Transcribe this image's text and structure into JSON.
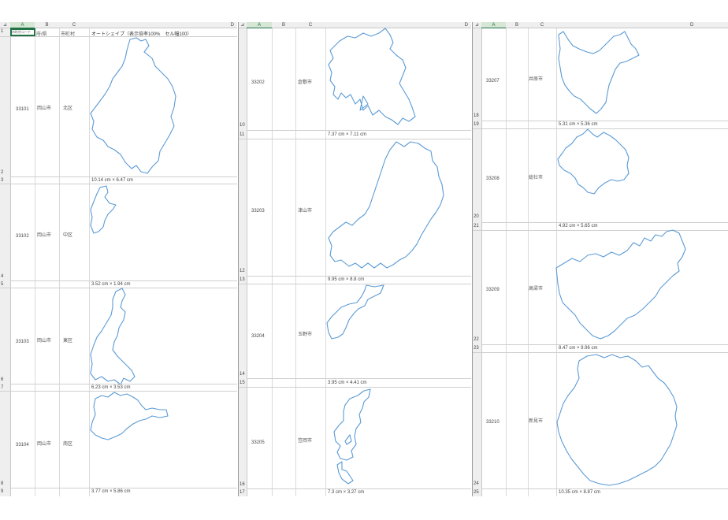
{
  "header": {
    "corner_marker": "⊿",
    "cols": [
      "A",
      "B",
      "C",
      "D"
    ],
    "row1": {
      "a": "市町村コード",
      "b": "府/県",
      "c": "市町村",
      "d": "オートシェイプ（表示倍率100%　セル幅100）"
    }
  },
  "panes": [
    {
      "rows": [
        {
          "num": "2",
          "code": "33101",
          "pref": "岡山市",
          "city": "北区"
        },
        {
          "num": "3",
          "dim": "10.14 cm × 6.47 cm"
        },
        {
          "num": "4",
          "code": "33102",
          "pref": "岡山市",
          "city": "中区"
        },
        {
          "num": "5",
          "dim": "3.52 cm × 1.94 cm"
        },
        {
          "num": "6",
          "code": "33103",
          "pref": "岡山市",
          "city": "東区"
        },
        {
          "num": "7",
          "dim": "6.23 cm × 3.53 cm"
        },
        {
          "num": "8",
          "code": "33104",
          "pref": "岡山市",
          "city": "南区"
        },
        {
          "num": "9",
          "dim": "3.77 cm × 5.86 cm"
        }
      ]
    },
    {
      "rows": [
        {
          "num": "10",
          "code": "33202",
          "pref": "",
          "city": "倉敷市"
        },
        {
          "num": "11",
          "dim": "7.37 cm × 7.11 cm"
        },
        {
          "num": "12",
          "code": "33203",
          "pref": "",
          "city": "津山市"
        },
        {
          "num": "13",
          "dim": "9.95 cm × 8.8 cm"
        },
        {
          "num": "14",
          "code": "33204",
          "pref": "",
          "city": "玉野市"
        },
        {
          "num": "15",
          "dim": "3.95 cm × 4.41 cm"
        },
        {
          "num": "16",
          "code": "33205",
          "pref": "",
          "city": "笠岡市"
        },
        {
          "num": "17",
          "dim": "7.3 cm × 3.27 cm"
        }
      ]
    },
    {
      "rows": [
        {
          "num": "18",
          "code": "33207",
          "pref": "",
          "city": "井原市"
        },
        {
          "num": "19",
          "dim": "5.31 cm × 5.36 cm"
        },
        {
          "num": "20",
          "code": "33208",
          "pref": "",
          "city": "総社市"
        },
        {
          "num": "21",
          "dim": "4.92 cm × 5.65 cm"
        },
        {
          "num": "22",
          "code": "33209",
          "pref": "",
          "city": "高梁市"
        },
        {
          "num": "23",
          "dim": "8.47 cm × 9.96 cm"
        },
        {
          "num": "24",
          "code": "33210",
          "pref": "",
          "city": "新見市"
        },
        {
          "num": "25",
          "dim": "10.35 cm × 8.87 cm"
        }
      ]
    }
  ]
}
